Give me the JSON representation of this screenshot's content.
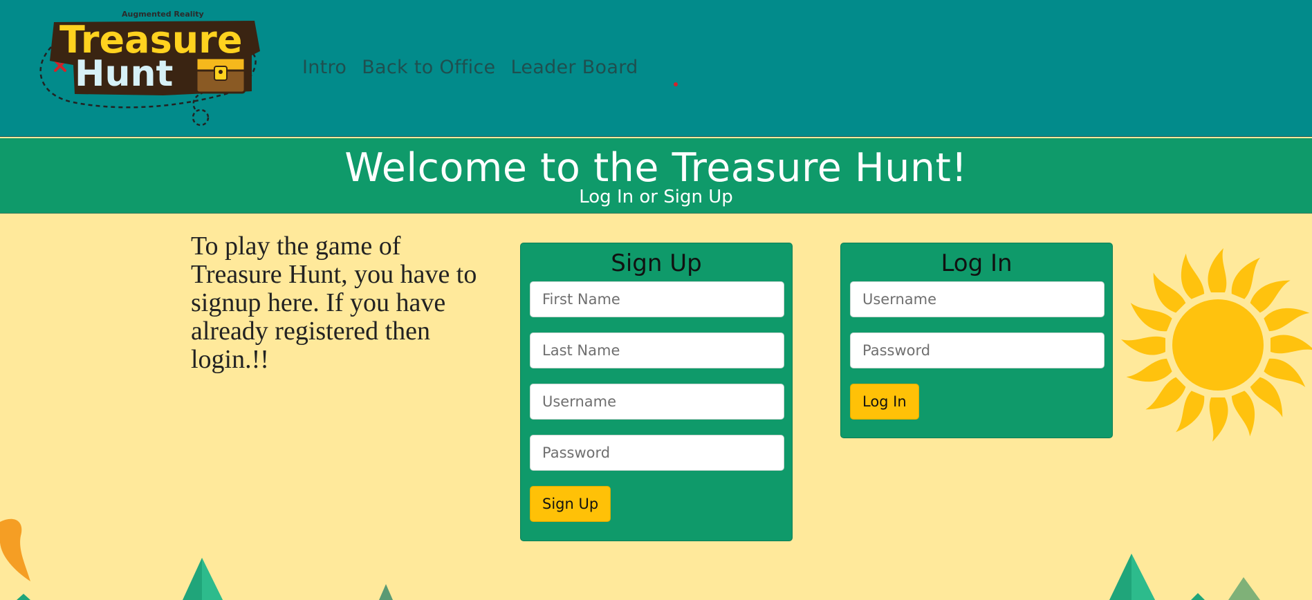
{
  "logo": {
    "tagline": "Augmented Reality",
    "line1": "Treasure",
    "line2": "Hunt"
  },
  "nav": {
    "items": [
      "Intro",
      "Back to Office",
      "Leader Board"
    ]
  },
  "welcome": {
    "title": "Welcome to the Treasure Hunt!",
    "subtitle": "Log In or Sign Up"
  },
  "intro_text": "To play the game of Treasure Hunt, you have to signup here. If you have already registered then login.!!",
  "signup": {
    "title": "Sign Up",
    "first_name_placeholder": "First Name",
    "last_name_placeholder": "Last Name",
    "username_placeholder": "Username",
    "password_placeholder": "Password",
    "button_label": "Sign Up"
  },
  "login": {
    "title": "Log In",
    "username_placeholder": "Username",
    "password_placeholder": "Password",
    "button_label": "Log In"
  },
  "colors": {
    "header_bg": "#028b8b",
    "band_bg": "#0f9a6a",
    "page_bg": "#ffe99b",
    "button": "#ffc107",
    "sun": "#ffc20e"
  }
}
